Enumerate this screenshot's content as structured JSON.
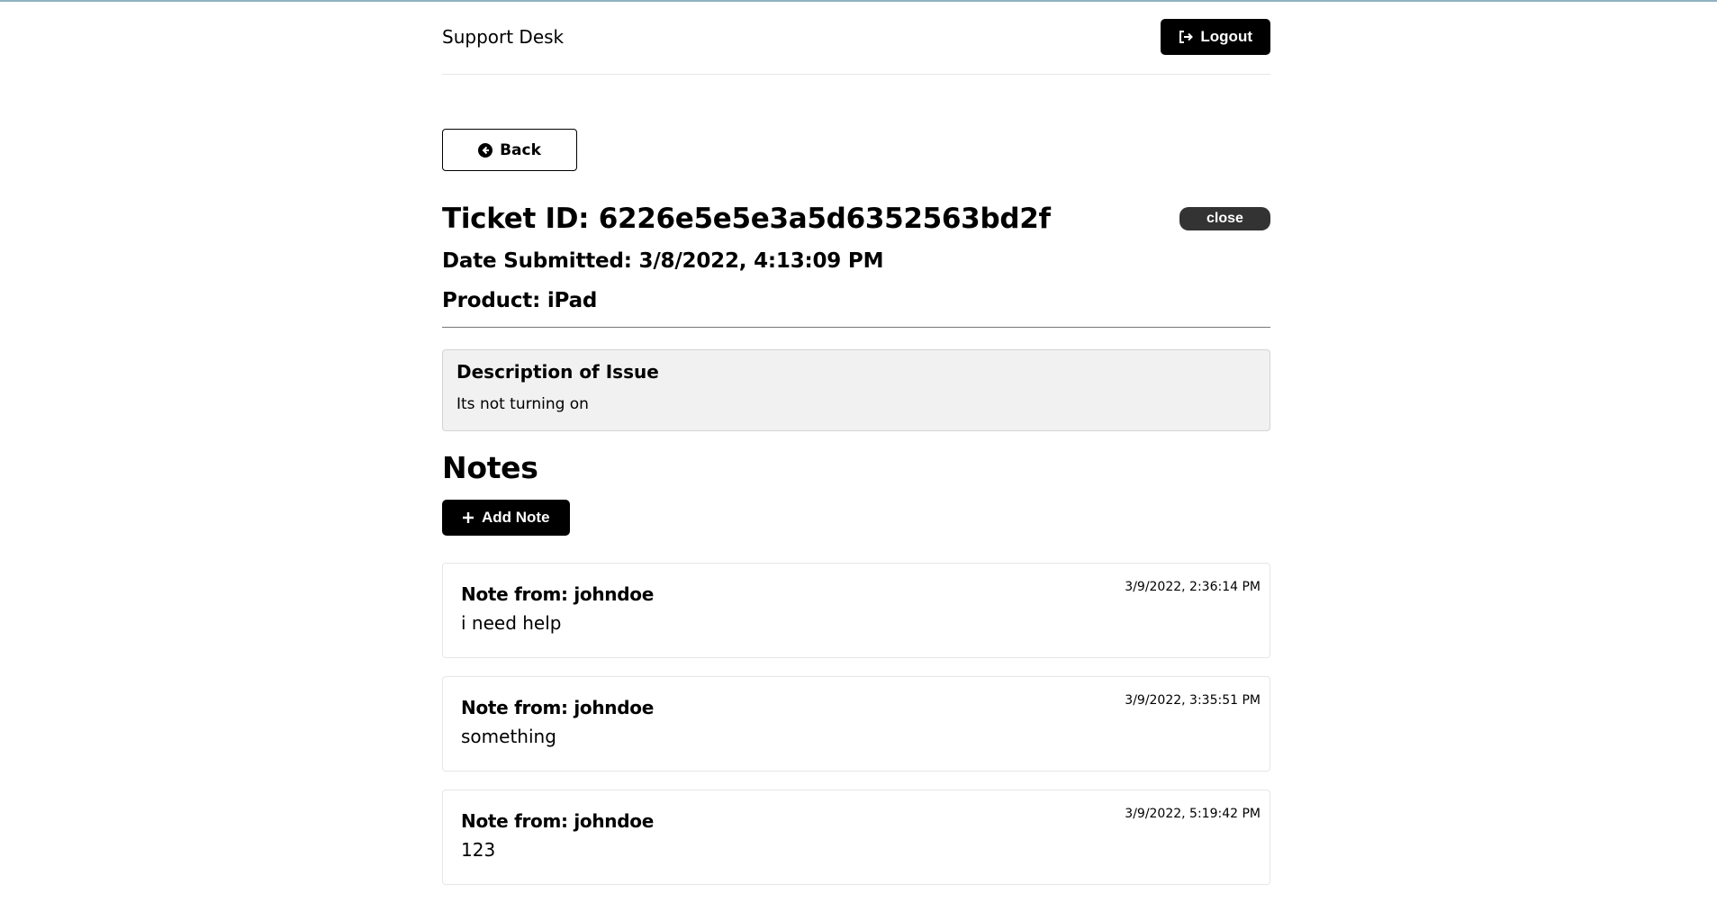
{
  "header": {
    "title": "Support Desk",
    "logout_label": "Logout",
    "logout_icon": "sign-out-icon"
  },
  "back": {
    "label": "Back",
    "icon": "arrow-circle-left-icon"
  },
  "ticket": {
    "title": "Ticket ID: 6226e5e5e3a5d6352563bd2f",
    "status": "close",
    "date_submitted": "Date Submitted: 3/8/2022, 4:13:09 PM",
    "product": "Product: iPad"
  },
  "description": {
    "heading": "Description of Issue",
    "text": "Its not turning on"
  },
  "notes": {
    "heading": "Notes",
    "add_label": "Add Note",
    "add_icon": "plus-icon",
    "items": [
      {
        "author": "Note from: johndoe",
        "text": "i need help",
        "date": "3/9/2022, 2:36:14 PM"
      },
      {
        "author": "Note from: johndoe",
        "text": "something",
        "date": "3/9/2022, 3:35:51 PM"
      },
      {
        "author": "Note from: johndoe",
        "text": "123",
        "date": "3/9/2022, 5:19:42 PM"
      }
    ]
  },
  "colors": {
    "top_border": "#8fb3c2",
    "dark_button": "#000000",
    "status_badge": "#333333",
    "description_bg": "#f1f1f1"
  }
}
